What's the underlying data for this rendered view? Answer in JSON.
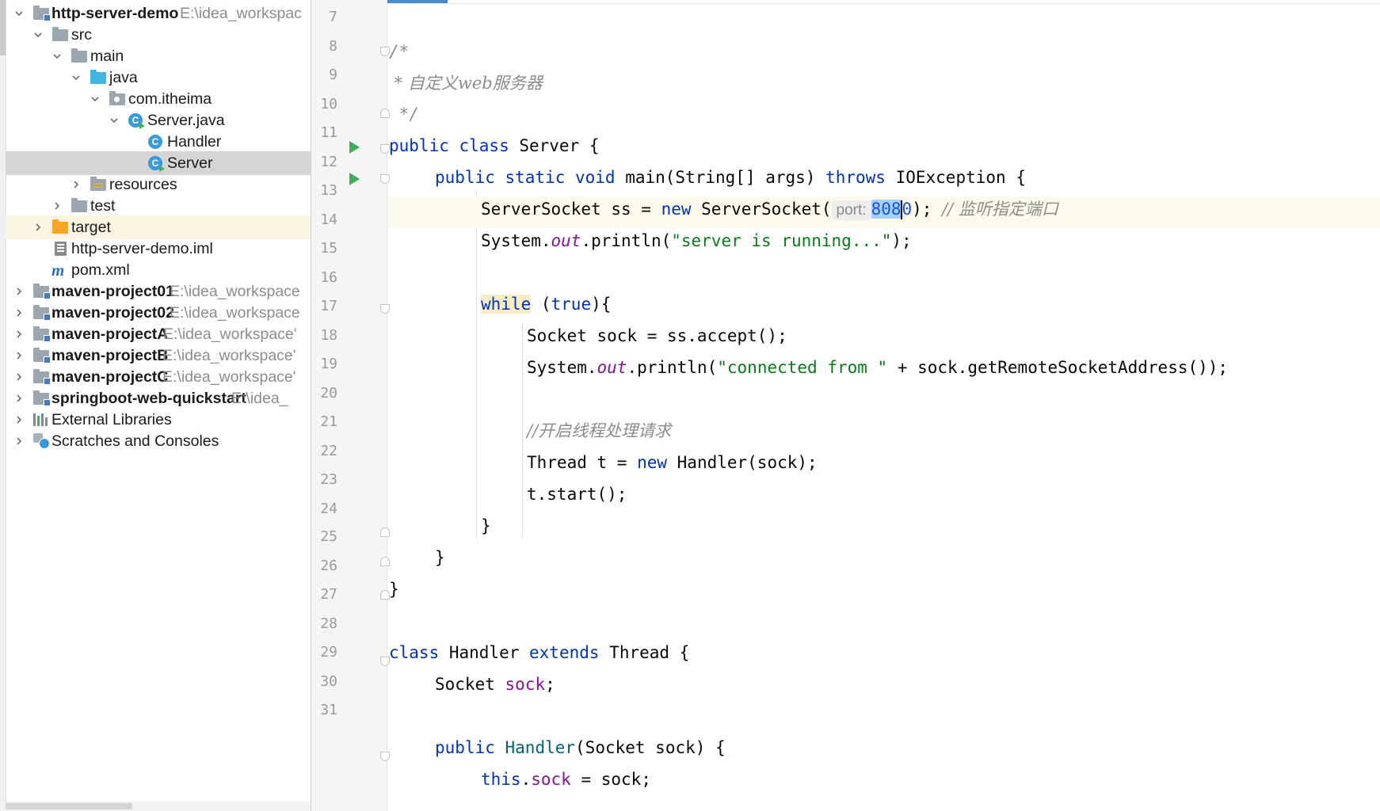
{
  "tree": {
    "rows": [
      {
        "label": "http-server-demo",
        "path": "E:\\idea_workspac",
        "bold": true
      },
      {
        "label": "src"
      },
      {
        "label": "main"
      },
      {
        "label": "java"
      },
      {
        "label": "com.itheima"
      },
      {
        "label": "Server.java"
      },
      {
        "label": "Handler"
      },
      {
        "label": "Server"
      },
      {
        "label": "resources"
      },
      {
        "label": "test"
      },
      {
        "label": "target"
      },
      {
        "label": "http-server-demo.iml"
      },
      {
        "label": "pom.xml"
      },
      {
        "label": "maven-project01",
        "path": "E:\\idea_workspace",
        "bold": true
      },
      {
        "label": "maven-project02",
        "path": "E:\\idea_workspace",
        "bold": true
      },
      {
        "label": "maven-projectA",
        "path": "E:\\idea_workspace'",
        "bold": true
      },
      {
        "label": "maven-projectB",
        "path": "E:\\idea_workspace'",
        "bold": true
      },
      {
        "label": "maven-projectC",
        "path": "E:\\idea_workspace'",
        "bold": true
      },
      {
        "label": "springboot-web-quickstart",
        "path": "E:\\idea_",
        "bold": true
      },
      {
        "label": "External Libraries"
      },
      {
        "label": "Scratches and Consoles"
      }
    ],
    "icons": {
      "module": "module-folder-icon",
      "folder": "folder-icon",
      "source": "source-folder-icon",
      "package": "package-icon",
      "class": "java-class-icon",
      "excluded": "excluded-folder-icon",
      "iml": "iml-file-icon",
      "maven": "maven-icon",
      "libraries": "libraries-icon",
      "scratches": "scratches-icon"
    }
  },
  "editor": {
    "lines": [
      {
        "n": "7"
      },
      {
        "n": "8"
      },
      {
        "n": "9"
      },
      {
        "n": "10"
      },
      {
        "n": "11"
      },
      {
        "n": "12"
      },
      {
        "n": "13"
      },
      {
        "n": "14"
      },
      {
        "n": "15"
      },
      {
        "n": "16"
      },
      {
        "n": "17"
      },
      {
        "n": "18"
      },
      {
        "n": "19"
      },
      {
        "n": "20"
      },
      {
        "n": "21"
      },
      {
        "n": "22"
      },
      {
        "n": "23"
      },
      {
        "n": "24"
      },
      {
        "n": "25"
      },
      {
        "n": "26"
      },
      {
        "n": "27"
      },
      {
        "n": "28"
      },
      {
        "n": "29"
      },
      {
        "n": "30"
      },
      {
        "n": "31"
      }
    ],
    "code": {
      "l8": "/*",
      "l9": " * 自定义web服务器",
      "l10": " */",
      "l11_kw": "public class",
      "l11_rest": " Server {",
      "l12_kw": "public static void",
      "l12_mid": " main(String[] args) ",
      "l12_kw2": "throws",
      "l12_rest": " IOException {",
      "l13_a": "ServerSocket ss = ",
      "l13_kw": "new",
      "l13_b": " ServerSocket(",
      "l13_hint": "port:",
      "l13_num": "808",
      "l13_numtail": "0",
      "l13_c": "); ",
      "l13_comment": "// 监听指定端口",
      "l14_a": "System.",
      "l14_out": "out",
      "l14_b": ".println(",
      "l14_str": "\"server is running...\"",
      "l14_c": ");",
      "l16_kw": "while",
      "l16_b": " (",
      "l16_kw2": "true",
      "l16_c": "){",
      "l17": "Socket sock = ss.accept();",
      "l18_a": "System.",
      "l18_out": "out",
      "l18_b": ".println(",
      "l18_str": "\"connected from \"",
      "l18_c": " + sock.getRemoteSocketAddress());",
      "l20": "//开启线程处理请求",
      "l21_a": "Thread t = ",
      "l21_kw": "new",
      "l21_b": " Handler(sock);",
      "l22": "t.start();",
      "l23": "}",
      "l24": "}",
      "l25": "}",
      "l27_kw": "class",
      "l27_a": " Handler ",
      "l27_kw2": "extends",
      "l27_b": " Thread {",
      "l28_a": "Socket ",
      "l28_f": "sock",
      "l28_b": ";",
      "l30_kw": "public",
      "l30_a": " ",
      "l30_name": "Handler",
      "l30_b": "(Socket sock) {",
      "l31_kw": "this",
      "l31_a": ".",
      "l31_f": "sock",
      "l31_b": " = sock;"
    }
  }
}
